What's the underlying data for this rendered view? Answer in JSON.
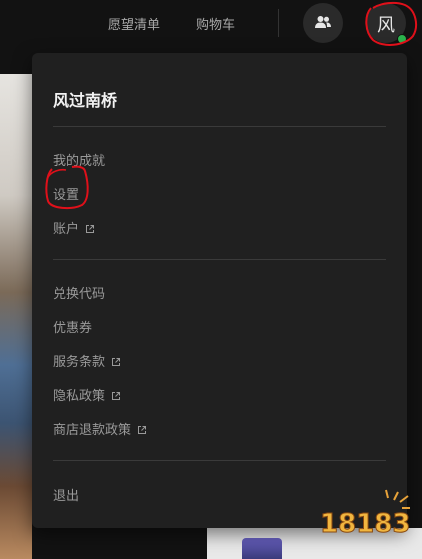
{
  "topbar": {
    "wishlist_label": "愿望清单",
    "cart_label": "购物车",
    "avatar_initial": "风",
    "friends_icon": "friends-icon",
    "status_color": "#2bb24c"
  },
  "menu": {
    "username": "风过南桥",
    "group1": {
      "achievements": "我的成就",
      "settings": "设置",
      "account": "账户"
    },
    "group2": {
      "redeem": "兑换代码",
      "coupons": "优惠券",
      "terms": "服务条款",
      "privacy": "隐私政策",
      "refund": "商店退款政策"
    },
    "signout": "退出"
  },
  "watermark": {
    "text": "18183"
  },
  "annotation_color": "#e0101a"
}
